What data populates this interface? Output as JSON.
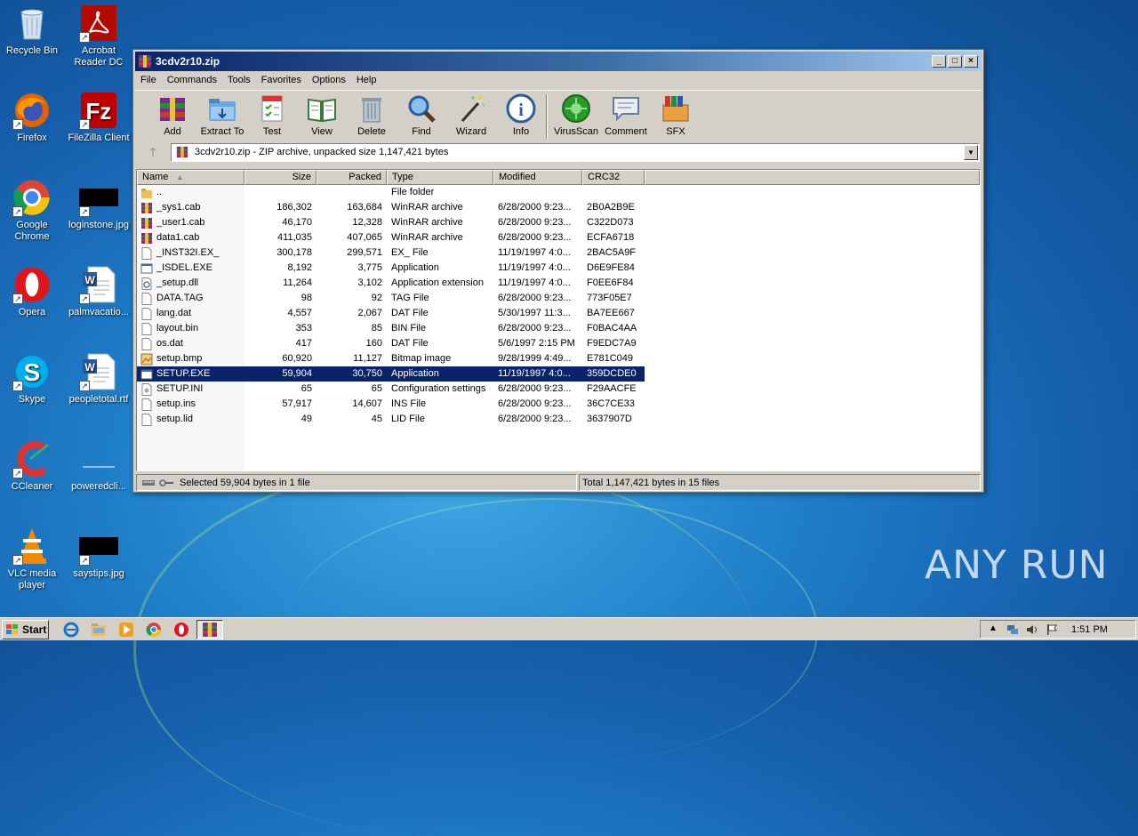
{
  "desktop": {
    "icons": [
      {
        "label": "Recycle Bin",
        "icon": "recycle-bin-icon"
      },
      {
        "label": "Acrobat Reader DC",
        "icon": "acrobat-icon"
      },
      {
        "label": "Firefox",
        "icon": "firefox-icon"
      },
      {
        "label": "FileZilla Client",
        "icon": "filezilla-icon"
      },
      {
        "label": "Google Chrome",
        "icon": "chrome-icon"
      },
      {
        "label": "loginstone.jpg",
        "icon": "image-file-icon"
      },
      {
        "label": "Opera",
        "icon": "opera-icon"
      },
      {
        "label": "palmvacatio...",
        "icon": "word-doc-icon"
      },
      {
        "label": "Skype",
        "icon": "skype-icon"
      },
      {
        "label": "peopletotal.rtf",
        "icon": "word-doc-icon"
      },
      {
        "label": "CCleaner",
        "icon": "ccleaner-icon"
      },
      {
        "label": "poweredcli...",
        "icon": "blank-file-icon"
      },
      {
        "label": "VLC media player",
        "icon": "vlc-icon"
      },
      {
        "label": "saystips.jpg",
        "icon": "image-file-icon"
      }
    ],
    "watermark": "ANY RUN"
  },
  "window": {
    "title": "3cdv2r10.zip",
    "menu": [
      "File",
      "Commands",
      "Tools",
      "Favorites",
      "Options",
      "Help"
    ],
    "toolbar": [
      {
        "label": "Add",
        "icon": "add-archive-icon"
      },
      {
        "label": "Extract To",
        "icon": "extract-folder-icon"
      },
      {
        "label": "Test",
        "icon": "test-checklist-icon"
      },
      {
        "label": "View",
        "icon": "view-book-icon"
      },
      {
        "label": "Delete",
        "icon": "trash-icon"
      },
      {
        "label": "Find",
        "icon": "magnifier-icon"
      },
      {
        "label": "Wizard",
        "icon": "wand-icon"
      },
      {
        "label": "Info",
        "icon": "info-icon"
      },
      {
        "label": "VirusScan",
        "icon": "virus-scan-icon"
      },
      {
        "label": "Comment",
        "icon": "comment-icon"
      },
      {
        "label": "SFX",
        "icon": "sfx-box-icon"
      }
    ],
    "address": "3cdv2r10.zip - ZIP archive, unpacked size 1,147,421 bytes",
    "columns": {
      "name": "Name",
      "size": "Size",
      "packed": "Packed",
      "type": "Type",
      "modified": "Modified",
      "crc": "CRC32"
    },
    "files": [
      {
        "name": "..",
        "size": "",
        "packed": "",
        "type": "File folder",
        "modified": "",
        "crc": "",
        "icon": "folder"
      },
      {
        "name": "_sys1.cab",
        "size": "186,302",
        "packed": "163,684",
        "type": "WinRAR archive",
        "modified": "6/28/2000 9:23...",
        "crc": "2B0A2B9E",
        "icon": "rar"
      },
      {
        "name": "_user1.cab",
        "size": "46,170",
        "packed": "12,328",
        "type": "WinRAR archive",
        "modified": "6/28/2000 9:23...",
        "crc": "C322D073",
        "icon": "rar"
      },
      {
        "name": "data1.cab",
        "size": "411,035",
        "packed": "407,065",
        "type": "WinRAR archive",
        "modified": "6/28/2000 9:23...",
        "crc": "ECFA6718",
        "icon": "rar"
      },
      {
        "name": "_INST32I.EX_",
        "size": "300,178",
        "packed": "299,571",
        "type": "EX_ File",
        "modified": "11/19/1997 4:0...",
        "crc": "2BAC5A9F",
        "icon": "file"
      },
      {
        "name": "_ISDEL.EXE",
        "size": "8,192",
        "packed": "3,775",
        "type": "Application",
        "modified": "11/19/1997 4:0...",
        "crc": "D6E9FE84",
        "icon": "exe"
      },
      {
        "name": "_setup.dll",
        "size": "11,264",
        "packed": "3,102",
        "type": "Application extension",
        "modified": "11/19/1997 4:0...",
        "crc": "F0EE6F84",
        "icon": "dll"
      },
      {
        "name": "DATA.TAG",
        "size": "98",
        "packed": "92",
        "type": "TAG File",
        "modified": "6/28/2000 9:23...",
        "crc": "773F05E7",
        "icon": "file"
      },
      {
        "name": "lang.dat",
        "size": "4,557",
        "packed": "2,067",
        "type": "DAT File",
        "modified": "5/30/1997 11:3...",
        "crc": "BA7EE667",
        "icon": "file"
      },
      {
        "name": "layout.bin",
        "size": "353",
        "packed": "85",
        "type": "BIN File",
        "modified": "6/28/2000 9:23...",
        "crc": "F0BAC4AA",
        "icon": "file"
      },
      {
        "name": "os.dat",
        "size": "417",
        "packed": "160",
        "type": "DAT File",
        "modified": "5/6/1997 2:15 PM",
        "crc": "F9EDC7A9",
        "icon": "file"
      },
      {
        "name": "setup.bmp",
        "size": "60,920",
        "packed": "11,127",
        "type": "Bitmap image",
        "modified": "9/28/1999 4:49...",
        "crc": "E781C049",
        "icon": "bmp"
      },
      {
        "name": "SETUP.EXE",
        "size": "59,904",
        "packed": "30,750",
        "type": "Application",
        "modified": "11/19/1997 4:0...",
        "crc": "359DCDE0",
        "icon": "exe",
        "selected": true
      },
      {
        "name": "SETUP.INI",
        "size": "65",
        "packed": "65",
        "type": "Configuration settings",
        "modified": "6/28/2000 9:23...",
        "crc": "F29AACFE",
        "icon": "ini"
      },
      {
        "name": "setup.ins",
        "size": "57,917",
        "packed": "14,607",
        "type": "INS File",
        "modified": "6/28/2000 9:23...",
        "crc": "36C7CE33",
        "icon": "file"
      },
      {
        "name": "setup.lid",
        "size": "49",
        "packed": "45",
        "type": "LID File",
        "modified": "6/28/2000 9:23...",
        "crc": "3637907D",
        "icon": "file"
      }
    ],
    "status_left": "Selected 59,904 bytes in 1 file",
    "status_right": "Total 1,147,421 bytes in 15 files"
  },
  "taskbar": {
    "start": "Start",
    "quicklaunch": [
      "ie-icon",
      "explorer-icon",
      "media-player-icon",
      "chrome-icon",
      "opera-icon"
    ],
    "active_task_icon": "winrar-icon",
    "clock": "1:51 PM"
  }
}
